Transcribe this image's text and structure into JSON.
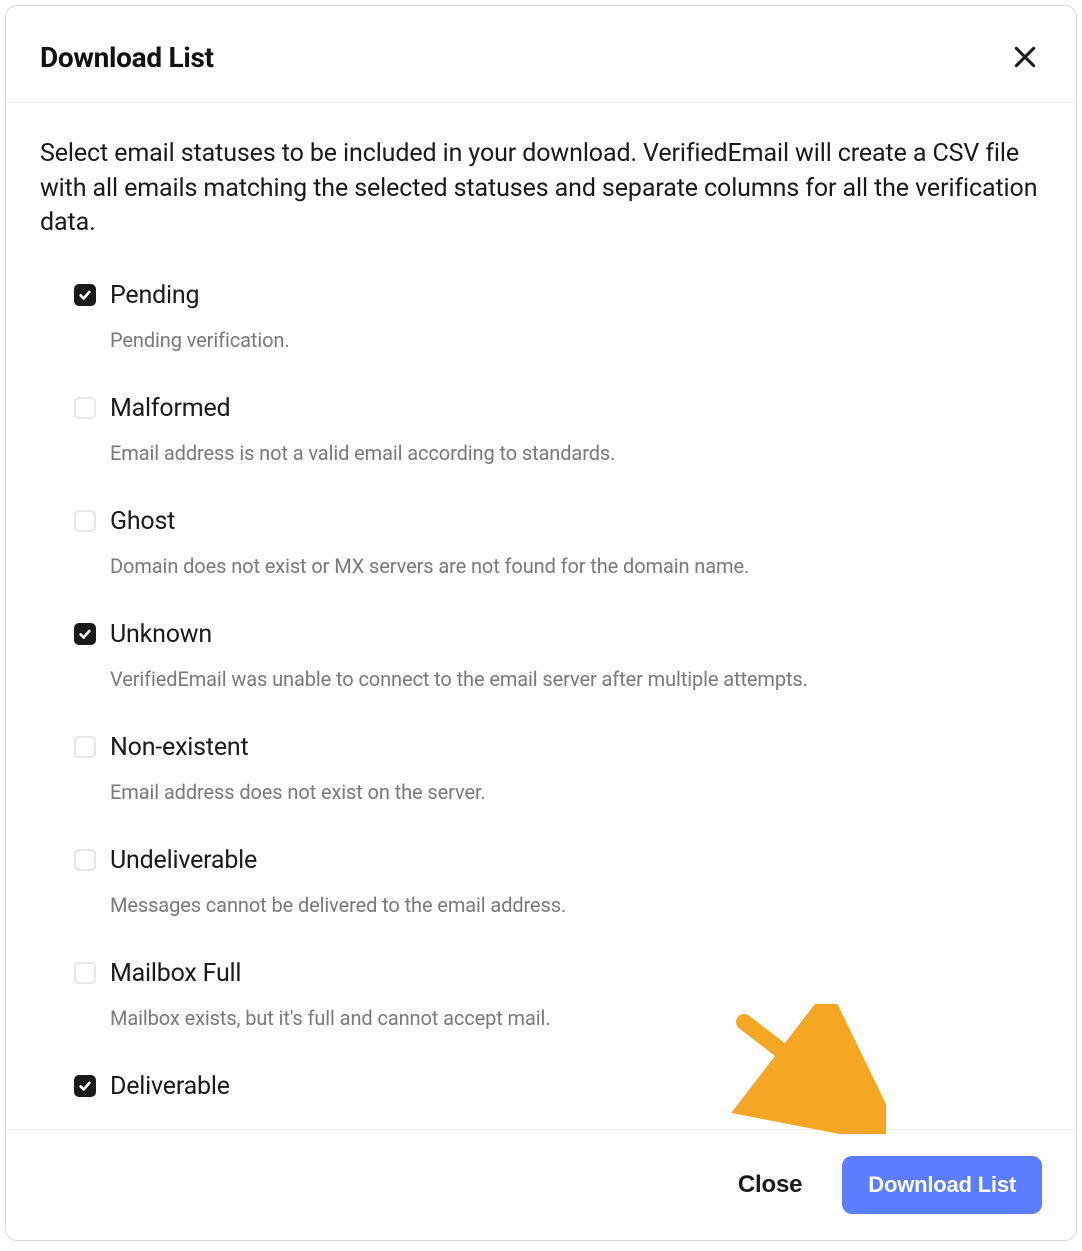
{
  "dialog": {
    "title": "Download List",
    "intro": "Select email statuses to be included in your download. VerifiedEmail will create a CSV file with all emails matching the selected statuses and separate columns for all the verification data.",
    "statuses": [
      {
        "label": "Pending",
        "checked": true,
        "desc": "Pending verification."
      },
      {
        "label": "Malformed",
        "checked": false,
        "desc": "Email address is not a valid email according to standards."
      },
      {
        "label": "Ghost",
        "checked": false,
        "desc": "Domain does not exist or MX servers are not found for the domain name."
      },
      {
        "label": "Unknown",
        "checked": true,
        "desc": "VerifiedEmail was unable to connect to the email server after multiple attempts."
      },
      {
        "label": "Non-existent",
        "checked": false,
        "desc": "Email address does not exist on the server."
      },
      {
        "label": "Undeliverable",
        "checked": false,
        "desc": "Messages cannot be delivered to the email address."
      },
      {
        "label": "Mailbox Full",
        "checked": false,
        "desc": "Mailbox exists, but it's full and cannot accept mail."
      },
      {
        "label": "Deliverable",
        "checked": true,
        "desc": ""
      }
    ],
    "footer": {
      "close_label": "Close",
      "primary_label": "Download List"
    }
  },
  "colors": {
    "primary": "#5b7dff",
    "checkbox_checked": "#1a1a1a",
    "arrow": "#f5a623"
  }
}
